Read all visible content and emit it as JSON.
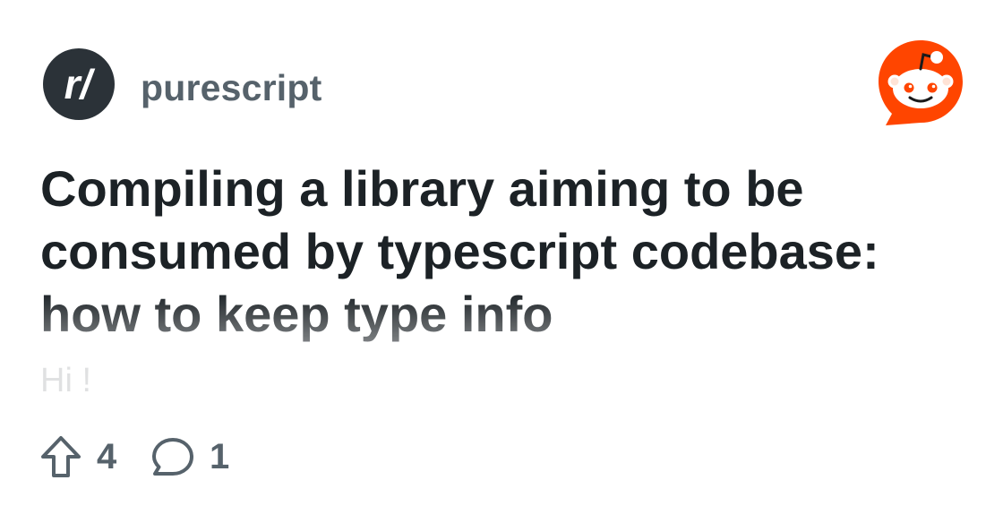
{
  "subreddit": {
    "name": "purescript",
    "avatar_text": "r/",
    "avatar_color": "#2b3238"
  },
  "brand": {
    "logo_icon": "reddit-snoo-icon",
    "logo_color": "#ff4500"
  },
  "post": {
    "title": "Compiling a library aiming to be consumed by typescript codebase: how to keep type info",
    "body_preview": "Hi !"
  },
  "stats": {
    "upvotes": "4",
    "upvote_icon": "upvote-arrow-icon",
    "comments": "1",
    "comment_icon": "comment-bubble-icon"
  },
  "colors": {
    "title": "#1c2226",
    "meta": "#56626b"
  }
}
